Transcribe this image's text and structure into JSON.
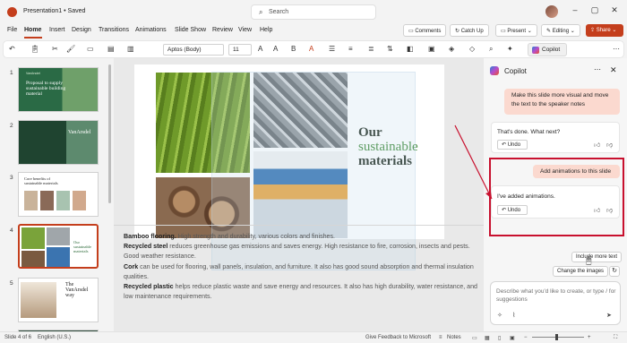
{
  "titlebar": {
    "doc_title": "Presentation1 • Saved",
    "search_placeholder": "Search"
  },
  "menu": {
    "items": [
      "File",
      "Home",
      "Insert",
      "Design",
      "Transitions",
      "Animations",
      "Slide Show",
      "Review",
      "View",
      "Help"
    ],
    "active": "Home"
  },
  "header_buttons": {
    "comments": "Comments",
    "catch_up": "Catch Up",
    "present": "Present",
    "editing": "Editing",
    "share": "Share"
  },
  "ribbon": {
    "font": "Aptos (Body)",
    "size": "11",
    "copilot": "Copilot"
  },
  "thumbnails": {
    "numbers": [
      "1",
      "2",
      "3",
      "4",
      "5"
    ],
    "slide1_title": "Proposal to supply sustainable building material",
    "slide1_logo": "VanArsdel",
    "slide2_logo": "VanArsdel",
    "slide3_title": "Core benefits of sustainable materials",
    "slide4_title": "Our sustainable materials",
    "slide5_title": "The VanArsdel way"
  },
  "slide": {
    "title_line1": "Our",
    "title_line2": "sustainable",
    "title_line3": "materials"
  },
  "notes": {
    "p1_bold": "Bamboo flooring.",
    "p1_text": " High strength and durability, various colors and finishes.",
    "p2_bold": "Recycled steel",
    "p2_text": " reduces greenhouse gas emissions and saves energy. High resistance to fire, corrosion, insects and pests. Good weather resistance.",
    "p3_bold": "Cork",
    "p3_text": " can be used for flooring, wall panels, insulation, and furniture. It also has good sound absorption and thermal insulation qualities.",
    "p4_bold": "Recycled plastic",
    "p4_text": " helps reduce plastic waste and save energy and resources. It also has high durability, water resistance, and low maintenance requirements."
  },
  "copilot": {
    "title": "Copilot",
    "msg1": "Make this slide more visual and move the text to the speaker notes",
    "reply1": "That's done. What next?",
    "undo": "Undo",
    "msg2": "Add animations to this slide",
    "reply2": "I've added animations.",
    "suggestion1": "Include more text",
    "suggestion2": "Change the images",
    "input_placeholder": "Describe what you'd like to create, or type / for suggestions"
  },
  "status": {
    "slide_info": "Slide 4 of 6",
    "language": "English (U.S.)",
    "feedback": "Give Feedback to Microsoft",
    "notes": "Notes"
  },
  "colors": {
    "accent": "#c43e1c",
    "highlight": "#c8102e",
    "user_bubble": "#fbd9cf"
  }
}
